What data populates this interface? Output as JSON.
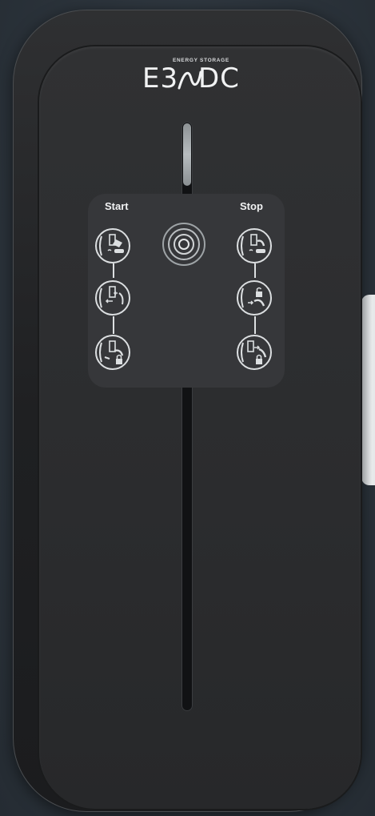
{
  "brand": {
    "logo_name": "E3/DC",
    "tagline": "ENERGY STORAGE",
    "logo_left": "E3",
    "logo_right": "DC"
  },
  "panel": {
    "start_label": "Start",
    "stop_label": "Stop",
    "rfid_icon": "rfid-waves-icon",
    "start_steps": [
      "card-key-icon",
      "plug-in-icon",
      "plug-lock-icon"
    ],
    "stop_steps": [
      "card-key-icon",
      "unlock-plug-icon",
      "unplug-lock-icon"
    ]
  },
  "colors": {
    "device_body": "#2b2c2e",
    "icon_stroke": "#dcdfe1",
    "led": "#aeb3b6",
    "background": "#2e363e"
  }
}
